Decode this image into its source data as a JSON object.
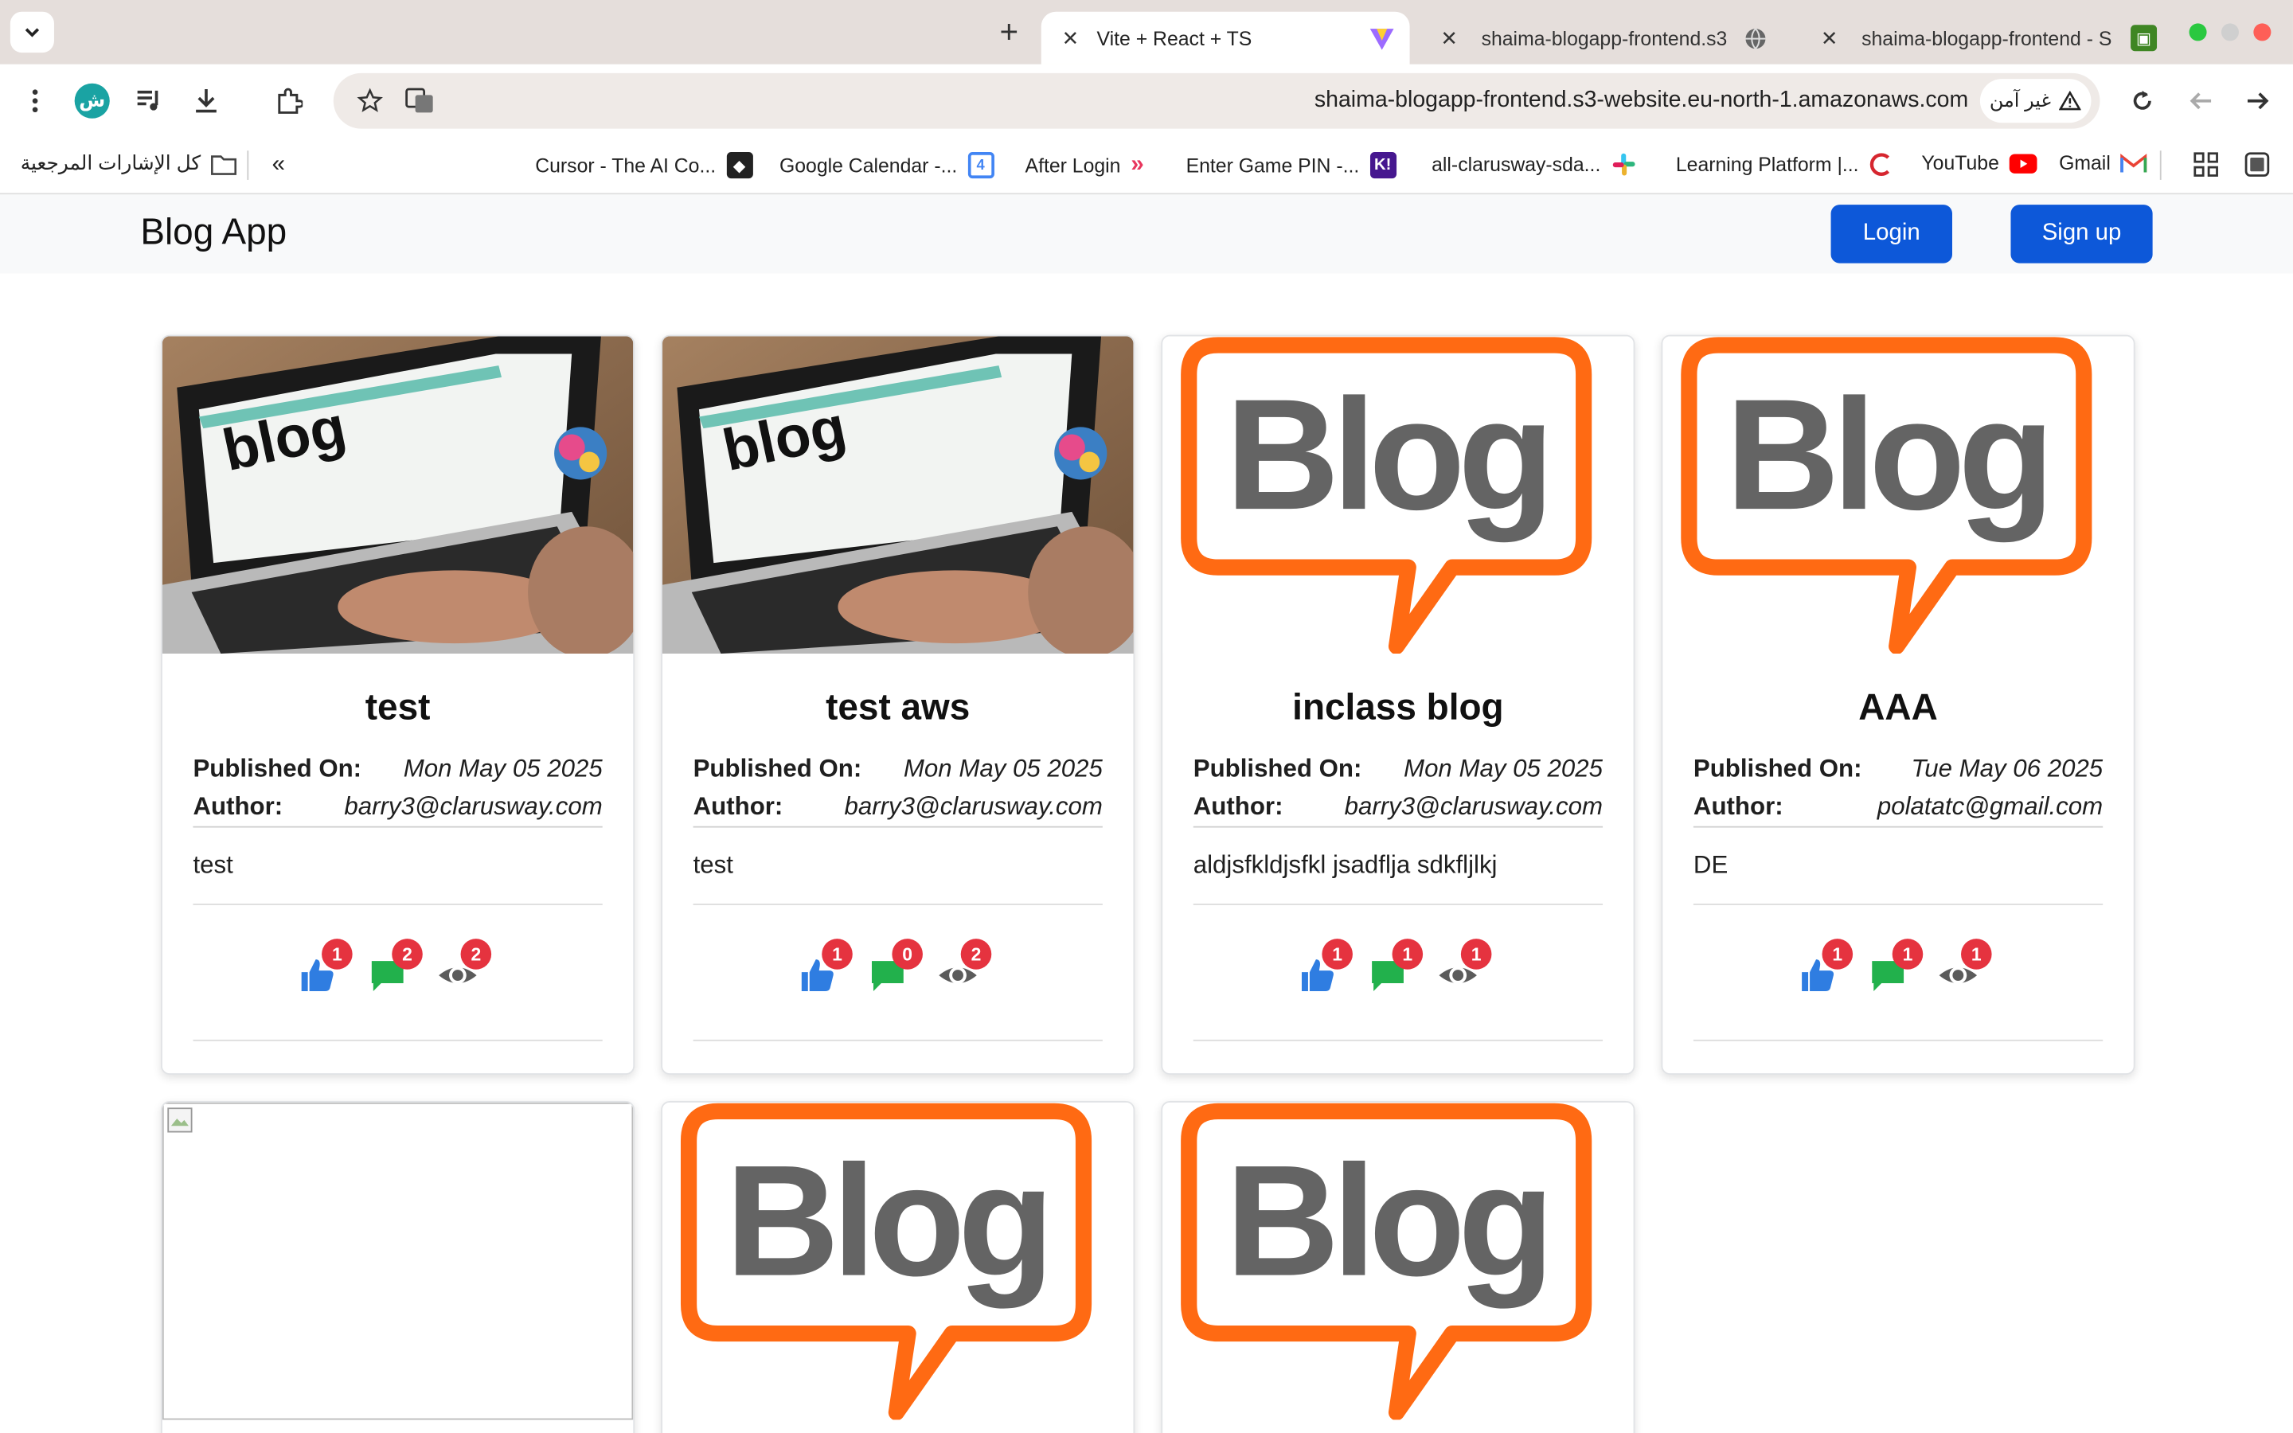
{
  "browser": {
    "tabs": [
      {
        "title": "Vite + React + TS"
      },
      {
        "title": "shaima-blogapp-frontend.s3"
      },
      {
        "title": "shaima-blogapp-frontend - S"
      }
    ],
    "new_tab": "+",
    "profile_initial": "ش",
    "url": "shaima-blogapp-frontend.s3-website.eu-north-1.amazonaws.com",
    "security_label": "غير آمن",
    "bookmarks_folder": "كل الإشارات المرجعية",
    "bookmarks": [
      {
        "label": "Cursor - The AI Co...",
        "icon": "cursor-icon",
        "color": "#222222"
      },
      {
        "label": "Google Calendar -...",
        "icon": "calendar-icon",
        "color": "#4285f4"
      },
      {
        "label": "After Login",
        "icon": "after-login-icon",
        "color": "#e8365d"
      },
      {
        "label": "Enter Game PIN -...",
        "icon": "kahoot-icon",
        "color": "#46178f"
      },
      {
        "label": "all-clarusway-sda...",
        "icon": "slack-icon",
        "color": "#e01e5a"
      },
      {
        "label": "Learning Platform |...",
        "icon": "learning-icon",
        "color": "#d6262f"
      },
      {
        "label": "YouTube",
        "icon": "youtube-icon",
        "color": "#ff0000"
      },
      {
        "label": "Gmail",
        "icon": "gmail-icon",
        "color": "#ea4335"
      }
    ]
  },
  "page": {
    "brand": "Blog App",
    "login": "Login",
    "signup": "Sign up",
    "published_label": "Published On:",
    "author_label": "Author:",
    "cards": [
      {
        "title": "test",
        "published": "Mon May 05 2025",
        "author": "barry3@clarusway.com",
        "content": "test",
        "likes": "1",
        "comments": "2",
        "views": "2",
        "image": "laptop-blog-photo"
      },
      {
        "title": "test aws",
        "published": "Mon May 05 2025",
        "author": "barry3@clarusway.com",
        "content": "test",
        "likes": "1",
        "comments": "0",
        "views": "2",
        "image": "laptop-blog-photo"
      },
      {
        "title": "inclass blog",
        "published": "Mon May 05 2025",
        "author": "barry3@clarusway.com",
        "content": "aldjsfkldjsfkl jsadflja sdkfljlkj",
        "likes": "1",
        "comments": "1",
        "views": "1",
        "image": "blog-speech-bubble-logo"
      },
      {
        "title": "AAA",
        "published": "Tue May 06 2025",
        "author": "polatatc@gmail.com",
        "content": "DE",
        "likes": "1",
        "comments": "1",
        "views": "1",
        "image": "blog-speech-bubble-logo"
      },
      {
        "image": "broken-image"
      },
      {
        "image": "blog-speech-bubble-logo"
      },
      {
        "image": "blog-speech-bubble-logo"
      }
    ],
    "logo_text": "Blog",
    "photo_text": "blog"
  },
  "colors": {
    "primary": "#0d58d9",
    "badge": "#e5333f",
    "like": "#2f7de1",
    "comment": "#22b14c",
    "view": "#5b5b5b",
    "logo_orange": "#ff6a13",
    "logo_gray": "#646464"
  }
}
